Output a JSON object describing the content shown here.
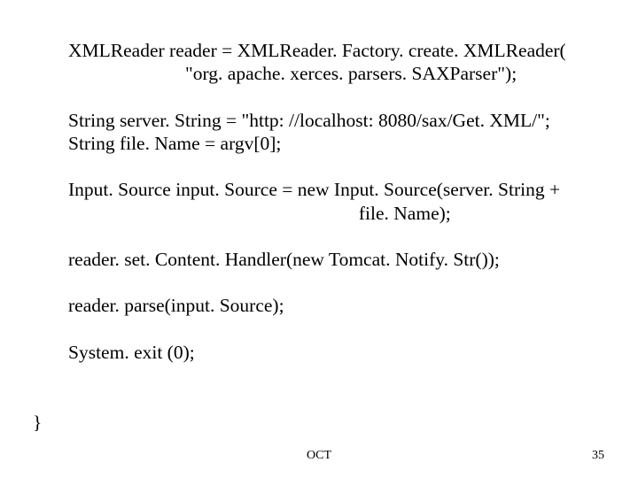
{
  "code": {
    "l1": "XMLReader reader = XMLReader. Factory. create. XMLReader(",
    "l2": "\"org. apache. xerces. parsers. SAXParser\");",
    "l3": "String server. String = \"http: //localhost: 8080/sax/Get. XML/\";",
    "l4": "String file. Name = argv[0];",
    "l5": "Input. Source input. Source = new Input. Source(server. String +",
    "l6": "                                                             file. Name);",
    "l7": "reader. set. Content. Handler(new Tomcat. Notify. Str());",
    "l8": "reader. parse(input. Source);",
    "l9": "System. exit (0);",
    "bracket": "}"
  },
  "footer": {
    "center": "OCT",
    "right": "35"
  }
}
